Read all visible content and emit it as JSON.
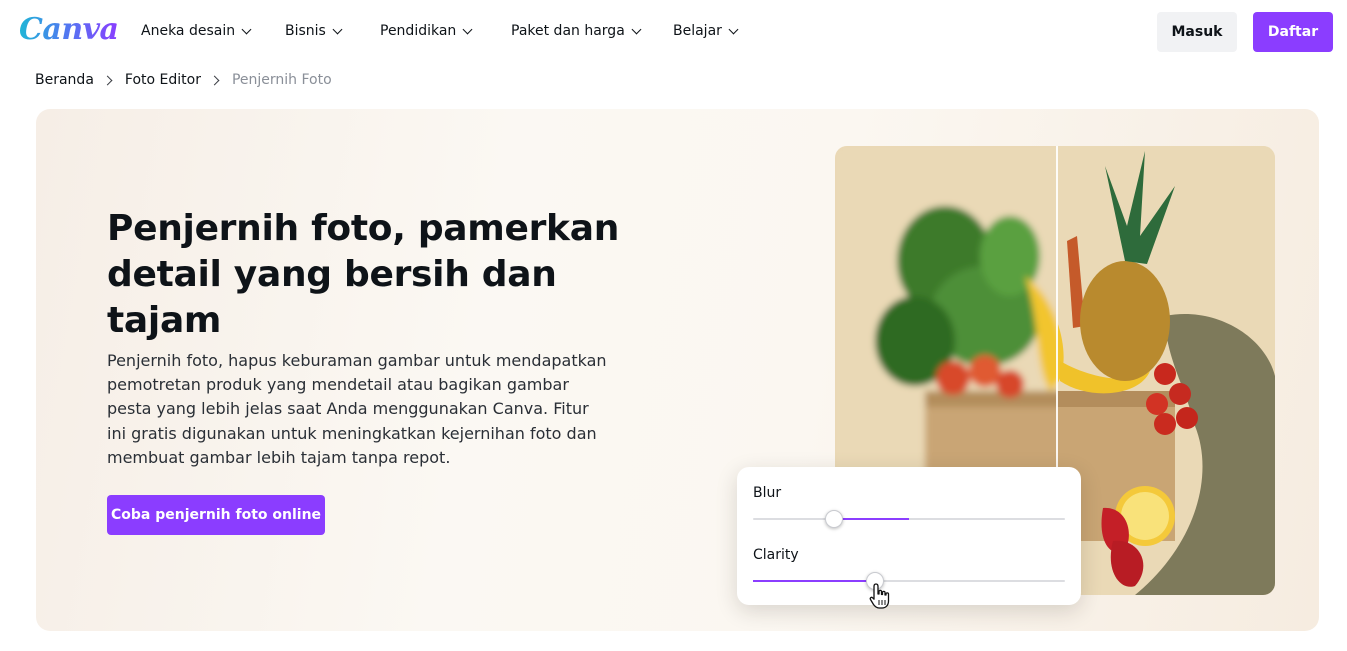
{
  "nav": {
    "logo": "Canva",
    "items": [
      {
        "label": "Aneka desain"
      },
      {
        "label": "Bisnis"
      },
      {
        "label": "Pendidikan"
      },
      {
        "label": "Paket dan harga"
      },
      {
        "label": "Belajar"
      }
    ],
    "login_label": "Masuk",
    "signup_label": "Daftar"
  },
  "breadcrumb": {
    "items": [
      "Beranda",
      "Foto Editor",
      "Penjernih Foto"
    ]
  },
  "hero": {
    "title": "Penjernih foto, pamerkan detail yang bersih dan tajam",
    "description": "Penjernih foto, hapus keburaman gambar untuk mendapatkan pemotretan produk yang mendetail atau bagikan gambar pesta yang lebih jelas saat Anda menggunakan Canva. Fitur ini gratis digunakan untuk meningkatkan kejernihan foto dan membuat gambar lebih tajam tanpa repot.",
    "cta_label": "Coba penjernih foto online"
  },
  "editor_card": {
    "sliders": [
      {
        "label": "Blur",
        "value": 0.5
      },
      {
        "label": "Clarity",
        "value": 0.39
      }
    ]
  },
  "colors": {
    "brand": "#8b3dff",
    "text": "#0e1318",
    "muted": "#8a8f98",
    "secondary_button": "#f1f2f4"
  },
  "icons": [
    "chevron-down-icon",
    "chevron-right-icon",
    "hand-pointer-icon"
  ]
}
